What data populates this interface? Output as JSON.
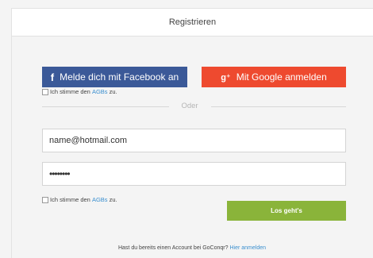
{
  "header": {
    "title": "Registrieren"
  },
  "social": {
    "facebook": {
      "icon": "facebook-icon",
      "label": "Melde dich mit Facebook an",
      "color": "#3b5998"
    },
    "google": {
      "icon": "google-plus-icon",
      "label": "Mit Google anmelden",
      "color": "#ee4a2f"
    }
  },
  "terms": {
    "prefix": "Ich stimme den ",
    "link": "AGBs",
    "suffix": " zu."
  },
  "divider": {
    "label": "Oder"
  },
  "form": {
    "email_value": "name@hotmail.com",
    "password_value": "••••••••",
    "submit_label": "Los geht's",
    "submit_color": "#8ab43a"
  },
  "footer": {
    "question": "Hast du bereits einen Account bei GoConqr? ",
    "link": "Hier anmelden"
  }
}
